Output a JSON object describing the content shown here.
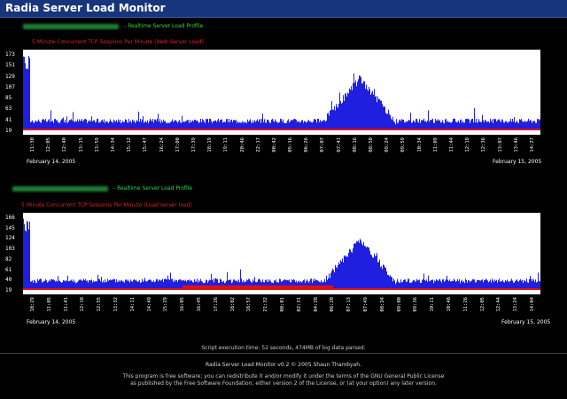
{
  "window": {
    "title": "Radia Server Load Monitor"
  },
  "chart1": {
    "heading": "- Realtime Server Load Profile",
    "subheading": "5 Minute Concurrent TCP Sessions Per Minute (Web Server Load)",
    "yticks": [
      "173",
      "151",
      "129",
      "107",
      "85",
      "63",
      "41",
      "19"
    ],
    "xticks": [
      "11:30",
      "12:05",
      "12:40",
      "13:15",
      "13:59",
      "14:34",
      "15:12",
      "15:47",
      "16:24",
      "17:00",
      "17:39",
      "18:19",
      "19:11",
      "20:46",
      "22:17",
      "00:42",
      "05:16",
      "06:26",
      "07:07",
      "07:41",
      "08:16",
      "08:50",
      "09:24",
      "09:59",
      "10:34",
      "11:09",
      "11:44",
      "12:18",
      "12:36",
      "13:07",
      "13:46",
      "14:27"
    ],
    "date_left": "February 14, 2005",
    "date_right": "February 15, 2005",
    "colors": {
      "bars": "#1f1fe0",
      "baseline": "#e01010"
    }
  },
  "chart2": {
    "heading": "- Realtime Server Load Profile",
    "subheading": "5 Minute Concurrent TCP Sessions Per Minute (Load server load)",
    "yticks": [
      "166",
      "145",
      "124",
      "103",
      "82",
      "61",
      "40",
      "19"
    ],
    "xticks": [
      "10:29",
      "11:05",
      "11:41",
      "12:18",
      "12:55",
      "13:32",
      "14:11",
      "14:49",
      "15:29",
      "16:05",
      "16:45",
      "17:26",
      "18:02",
      "18:57",
      "21:32",
      "00:01",
      "02:31",
      "04:28",
      "06:20",
      "07:13",
      "07:49",
      "08:24",
      "09:00",
      "09:36",
      "10:11",
      "10:48",
      "11:26",
      "12:05",
      "12:44",
      "13:24",
      "14:04"
    ],
    "date_left": "February 14, 2005",
    "date_right": "February 15, 2005",
    "colors": {
      "bars": "#1f1fe0",
      "baseline": "#e01010"
    }
  },
  "footer": {
    "execution": "Script execution time: 52 seconds, 474MB of log data parsed.",
    "copyright": "Radia Server Load Monitor v0.2 © 2005 Shaun Thambyah.",
    "license1": "This program is free software; you can redistribute it and/or modify it under the terms of the GNU General Public License",
    "license2": "as published by the Free Software Foundation; either version 2 of the License, or (at your option) any later version."
  }
}
